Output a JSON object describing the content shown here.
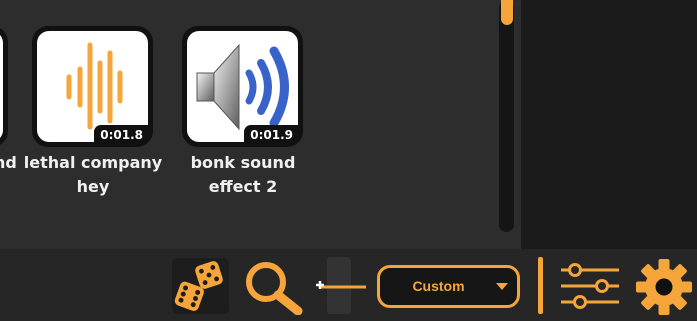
{
  "colors": {
    "accent": "#f5a53a",
    "speaker_waves": "#3a63c9"
  },
  "sounds": [
    {
      "label_end": "nd",
      "icon": "waveform-icon"
    },
    {
      "label": "lethal company hey",
      "duration": "0:01.8",
      "icon": "waveform-icon"
    },
    {
      "label": "bonk sound effect 2",
      "duration": "0:01.9",
      "icon": "speaker-icon"
    }
  ],
  "toolbar": {
    "random_icon": "dice-icon",
    "search_icon": "search-icon",
    "volume_icon": "volume-slider-icon",
    "preset": {
      "selected": "Custom"
    },
    "filters_icon": "sliders-icon",
    "settings_icon": "gear-icon"
  }
}
